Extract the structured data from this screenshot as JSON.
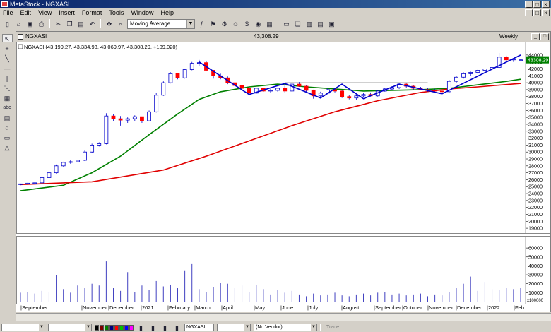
{
  "app": {
    "title": "MetaStock - NGXASI",
    "window_buttons": [
      "_",
      "□",
      "×"
    ],
    "mdi_buttons": [
      "_",
      "□",
      "×"
    ]
  },
  "menu": [
    "File",
    "Edit",
    "View",
    "Insert",
    "Format",
    "Tools",
    "Window",
    "Help"
  ],
  "toolbar": {
    "icons": [
      "new-icon",
      "open-icon",
      "save-icon",
      "print-icon",
      "cut-icon",
      "copy-icon",
      "paste-icon",
      "undo-icon",
      "crosshair-icon",
      "zoom-icon"
    ],
    "indicator_select": "Moving Average",
    "right_icons": [
      "indicator-builder-icon",
      "explorer-icon",
      "system-tester-icon",
      "expert-advisor-icon",
      "money-icon",
      "smart-charts-icon",
      "data-window-icon",
      "tile-icon",
      "cascade-icon",
      "layout-1-icon",
      "layout-2-icon",
      "layout-3-icon"
    ]
  },
  "left_tools": [
    {
      "name": "pointer-tool-icon",
      "glyph": "↖",
      "active": true
    },
    {
      "name": "crosshair-tool-icon",
      "glyph": "+"
    },
    {
      "name": "trendline-tool-icon",
      "glyph": "╲"
    },
    {
      "name": "horizontal-line-tool-icon",
      "glyph": "—"
    },
    {
      "name": "vertical-line-tool-icon",
      "glyph": "|"
    },
    {
      "name": "fan-tool-icon",
      "glyph": "⋱"
    },
    {
      "name": "grid-tool-icon",
      "glyph": "▦"
    },
    {
      "name": "text-tool-icon",
      "glyph": "abc"
    },
    {
      "name": "table-tool-icon",
      "glyph": "▤"
    },
    {
      "name": "ellipse-tool-icon",
      "glyph": "○"
    },
    {
      "name": "rectangle-tool-icon",
      "glyph": "▭"
    },
    {
      "name": "triangle-tool-icon",
      "glyph": "△"
    }
  ],
  "chart_window": {
    "title": "NGXASI",
    "last_value": "43,308.29",
    "periodicity": "Weekly",
    "legend": "NGXASI (43,199.27, 43,334.93, 43,069.97, 43,308.29, +109.020)",
    "price_marker": "43308.29",
    "volume_axis_suffix": "x100000"
  },
  "chart_data": {
    "type": "candlestick",
    "ylim": [
      18500,
      44600
    ],
    "price_ticks": [
      19000,
      20000,
      21000,
      22000,
      23000,
      24000,
      25000,
      26000,
      27000,
      28000,
      29000,
      30000,
      31000,
      32000,
      33000,
      34000,
      35000,
      36000,
      37000,
      38000,
      39000,
      40000,
      41000,
      42000,
      43000,
      44000
    ],
    "volume_ticks": [
      10000,
      20000,
      30000,
      40000,
      50000,
      60000
    ],
    "volume_ylim": [
      0,
      68000
    ],
    "x_labels": [
      "September",
      "November",
      "December",
      "2021",
      "February",
      "March",
      "April",
      "May",
      "June",
      "July",
      "August",
      "September",
      "October",
      "November",
      "December",
      "2022",
      "Feb"
    ],
    "candles": [
      [
        25300,
        25450,
        25200,
        25400
      ],
      [
        25400,
        25550,
        25300,
        25500
      ],
      [
        25500,
        25600,
        25400,
        25550
      ],
      [
        25550,
        26400,
        25500,
        26300
      ],
      [
        26300,
        27200,
        26200,
        27000
      ],
      [
        27000,
        28200,
        26900,
        28000
      ],
      [
        28000,
        28600,
        27900,
        28500
      ],
      [
        28500,
        28800,
        28300,
        28600
      ],
      [
        28600,
        28900,
        28500,
        28800
      ],
      [
        28800,
        30200,
        28700,
        30000
      ],
      [
        30000,
        31200,
        29900,
        31000
      ],
      [
        31000,
        31400,
        30800,
        31200
      ],
      [
        31200,
        35600,
        31100,
        35200
      ],
      [
        35200,
        35500,
        34500,
        34800
      ],
      [
        34800,
        35200,
        33800,
        34600
      ],
      [
        34600,
        35000,
        34200,
        34800
      ],
      [
        34800,
        35300,
        34500,
        35100
      ],
      [
        35100,
        35000,
        34200,
        34500
      ],
      [
        34500,
        36000,
        34400,
        35800
      ],
      [
        35800,
        38500,
        35700,
        38200
      ],
      [
        38200,
        40200,
        38100,
        40000
      ],
      [
        40000,
        41500,
        39900,
        41300
      ],
      [
        41300,
        41200,
        40500,
        40700
      ],
      [
        40700,
        42000,
        40600,
        41900
      ],
      [
        41900,
        43000,
        41800,
        42800
      ],
      [
        42800,
        43300,
        42400,
        42900
      ],
      [
        42900,
        43100,
        41700,
        41800
      ],
      [
        41800,
        41600,
        40600,
        41000
      ],
      [
        41000,
        41300,
        40500,
        40700
      ],
      [
        40700,
        40900,
        39800,
        40000
      ],
      [
        40000,
        40300,
        39400,
        39600
      ],
      [
        39600,
        39900,
        38900,
        39200
      ],
      [
        39200,
        39400,
        38300,
        38500
      ],
      [
        38500,
        39300,
        38400,
        39200
      ],
      [
        39200,
        39300,
        38700,
        38800
      ],
      [
        38800,
        39100,
        38500,
        38900
      ],
      [
        38900,
        39300,
        38700,
        39200
      ],
      [
        39200,
        39600,
        38600,
        38800
      ],
      [
        38800,
        39900,
        38700,
        39800
      ],
      [
        39800,
        40100,
        39400,
        39500
      ],
      [
        39500,
        39600,
        38700,
        38900
      ],
      [
        38900,
        39000,
        37700,
        38100
      ],
      [
        38100,
        38700,
        37800,
        38500
      ],
      [
        38500,
        39200,
        38400,
        39000
      ],
      [
        39000,
        39200,
        38600,
        38800
      ],
      [
        38800,
        39000,
        37800,
        38000
      ],
      [
        38000,
        38200,
        37600,
        37800
      ],
      [
        37800,
        38200,
        37500,
        38100
      ],
      [
        38100,
        38500,
        37900,
        38300
      ],
      [
        38300,
        38600,
        38000,
        38100
      ],
      [
        38100,
        38900,
        38000,
        38800
      ],
      [
        38800,
        39300,
        38700,
        39100
      ],
      [
        39100,
        39500,
        38900,
        39300
      ],
      [
        39300,
        39900,
        39100,
        39800
      ],
      [
        39800,
        39900,
        39300,
        39500
      ],
      [
        39500,
        39600,
        39000,
        39200
      ],
      [
        39200,
        39400,
        38900,
        39000
      ],
      [
        39000,
        39200,
        38700,
        38900
      ],
      [
        38900,
        39100,
        38600,
        38800
      ],
      [
        38800,
        39000,
        38500,
        38700
      ],
      [
        38700,
        40400,
        38600,
        40200
      ],
      [
        40200,
        41000,
        40000,
        40800
      ],
      [
        40800,
        41500,
        40600,
        41300
      ],
      [
        41300,
        41600,
        41000,
        41500
      ],
      [
        41500,
        41900,
        41300,
        41800
      ],
      [
        41800,
        42100,
        41600,
        42000
      ],
      [
        42000,
        42300,
        41900,
        42200
      ],
      [
        42200,
        44300,
        42100,
        43700
      ],
      [
        43700,
        43900,
        43100,
        43300
      ],
      [
        43300,
        43500,
        43000,
        43400
      ],
      [
        43199.27,
        43334.93,
        43069.97,
        43308.29
      ]
    ],
    "volumes": [
      10000,
      11000,
      9000,
      12000,
      11000,
      30000,
      14000,
      10000,
      18000,
      15000,
      20000,
      18000,
      45000,
      15000,
      12000,
      33000,
      11000,
      18000,
      13000,
      23000,
      17000,
      19000,
      15000,
      35000,
      42000,
      14000,
      11000,
      16000,
      21000,
      20000,
      15000,
      18000,
      11000,
      19000,
      14000,
      8000,
      13000,
      10000,
      12000,
      8000,
      6000,
      9000,
      7000,
      8000,
      10000,
      7000,
      6000,
      8000,
      9000,
      7000,
      10000,
      11000,
      8000,
      9000,
      7000,
      8000,
      9000,
      6000,
      8000,
      7000,
      11000,
      15000,
      20000,
      28000,
      12000,
      22000,
      14000,
      13000,
      15000,
      14000,
      15000
    ],
    "moving_averages": [
      {
        "name": "ma-short",
        "color": "#008000",
        "points": [
          [
            0,
            24400
          ],
          [
            6,
            25200
          ],
          [
            10,
            27000
          ],
          [
            14,
            29400
          ],
          [
            18,
            32500
          ],
          [
            22,
            35500
          ],
          [
            25,
            37600
          ],
          [
            28,
            38700
          ],
          [
            32,
            39400
          ],
          [
            36,
            39800
          ],
          [
            40,
            39400
          ],
          [
            44,
            39100
          ],
          [
            48,
            38800
          ],
          [
            52,
            38900
          ],
          [
            56,
            39000
          ],
          [
            60,
            39200
          ],
          [
            64,
            39700
          ],
          [
            68,
            40200
          ],
          [
            70,
            40500
          ]
        ]
      },
      {
        "name": "ma-long",
        "color": "#e00000",
        "points": [
          [
            0,
            25300
          ],
          [
            10,
            25700
          ],
          [
            20,
            27400
          ],
          [
            26,
            29400
          ],
          [
            32,
            31600
          ],
          [
            38,
            33800
          ],
          [
            44,
            35800
          ],
          [
            50,
            37400
          ],
          [
            56,
            38600
          ],
          [
            60,
            39100
          ],
          [
            64,
            39400
          ],
          [
            70,
            39900
          ]
        ]
      }
    ],
    "trendlines": [
      {
        "color": "#0000cc",
        "points": [
          [
            25,
            43000
          ],
          [
            32,
            38300
          ],
          [
            37,
            39900
          ],
          [
            42,
            37800
          ],
          [
            45,
            39800
          ],
          [
            48,
            37700
          ],
          [
            53,
            39800
          ],
          [
            59,
            38400
          ],
          [
            70,
            44000
          ]
        ]
      }
    ],
    "horizontal_line": {
      "value": 40000,
      "from": 37,
      "to": 57
    }
  },
  "bottom_bar": {
    "security_select": "NGXASI",
    "expert_select": "(No Vendor)",
    "trade_button": "Trade"
  },
  "colors": {
    "up_candle": "#ffffff",
    "down_candle": "#ff0000",
    "candle_outline": "#0000cc",
    "volume_bar": "#4040c0",
    "title_bar": "#0a246a",
    "price_marker_bg": "#008000"
  }
}
